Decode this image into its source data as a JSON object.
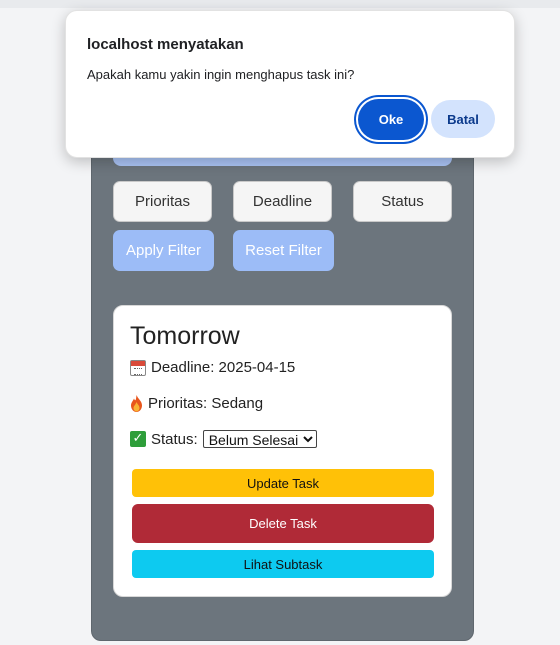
{
  "dialog": {
    "title": "localhost menyatakan",
    "message": "Apakah kamu yakin ingin menghapus task ini?",
    "ok_label": "Oke",
    "cancel_label": "Batal"
  },
  "filters": {
    "sort_buttons": [
      "Prioritas",
      "Deadline",
      "Status"
    ],
    "apply_label": "Apply Filter",
    "reset_label": "Reset Filter"
  },
  "task": {
    "title": "Tomorrow",
    "deadline_text": "Deadline: 2025-04-15",
    "priority_text": "Prioritas: Sedang",
    "status_label": "Status:",
    "status_value": "Belum Selesai",
    "update_label": "Update Task",
    "delete_label": "Delete Task",
    "subtask_label": "Lihat Subtask",
    "icons": {
      "deadline": "calendar-icon",
      "priority": "fire-icon",
      "status": "check-mark-icon"
    }
  },
  "colors": {
    "panel": "#6c757d",
    "filter_button": "#9cbcf7",
    "update": "#ffc107",
    "delete": "#b02a37",
    "subtask": "#0dcaf0",
    "dialog_primary": "#0b57d0",
    "dialog_secondary": "#d3e3fd"
  }
}
